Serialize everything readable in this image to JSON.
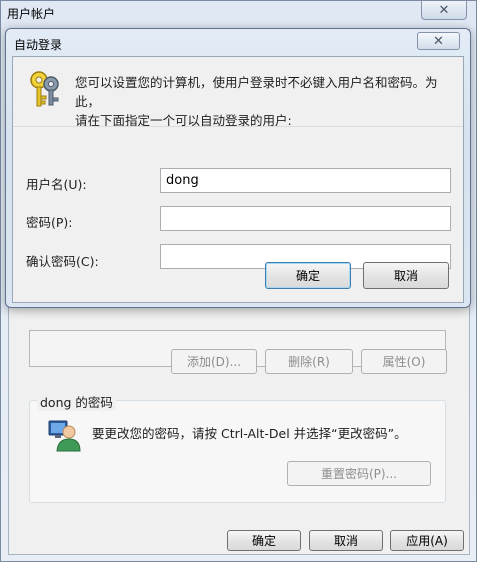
{
  "parent_window": {
    "title": "用户帐户",
    "close_glyph": "✕",
    "buttons": {
      "add": "添加(D)...",
      "remove": "删除(R)",
      "properties": "属性(O)"
    },
    "password_group": {
      "title": "dong 的密码",
      "text": "要更改您的密码，请按 Ctrl-Alt-Del 并选择“更改密码”。",
      "reset_button": "重置密码(P)..."
    },
    "footer": {
      "ok": "确定",
      "cancel": "取消",
      "apply": "应用(A)"
    }
  },
  "dialog": {
    "title": "自动登录",
    "close_glyph": "✕",
    "intro_line1": "您可以设置您的计算机，使用户登录时不必键入用户名和密码。为此，",
    "intro_line2": "请在下面指定一个可以自动登录的用户:",
    "fields": {
      "username_label": "用户名(U):",
      "username_value": "dong",
      "password_label": "密码(P):",
      "password_value": "",
      "confirm_label": "确认密码(C):",
      "confirm_value": ""
    },
    "ok": "确定",
    "cancel": "取消"
  },
  "colors": {
    "title_bar": "#dbe6f2",
    "client_bg": "#f0f0f0",
    "default_button_border": "#3c7fb1"
  },
  "icons": {
    "dialog_icon": "keys-icon",
    "password_icon": "user-computer-icon"
  }
}
